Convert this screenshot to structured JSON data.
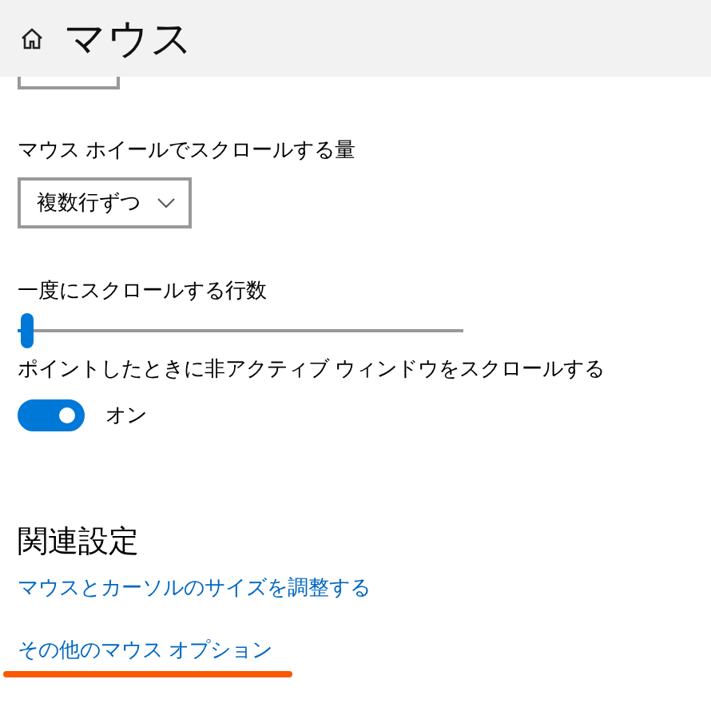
{
  "header": {
    "title": "マウス"
  },
  "clipped_control": {
    "kind": "dropdown"
  },
  "settings": [
    {
      "kind": "dropdown",
      "label": "マウス ホイールでスクロールする量",
      "value": "複数行ずつ"
    },
    {
      "kind": "slider",
      "label": "一度にスクロールする行数",
      "level": 0.02
    },
    {
      "kind": "toggle",
      "label": "ポイントしたときに非アクティブ ウィンドウをスクロールする",
      "on": true,
      "state_text": "オン"
    }
  ],
  "related": {
    "heading": "関連設定",
    "links": [
      {
        "text": "マウスとカーソルのサイズを調整する",
        "underlined": false
      },
      {
        "text": "その他のマウス オプション",
        "underlined": true
      }
    ]
  }
}
